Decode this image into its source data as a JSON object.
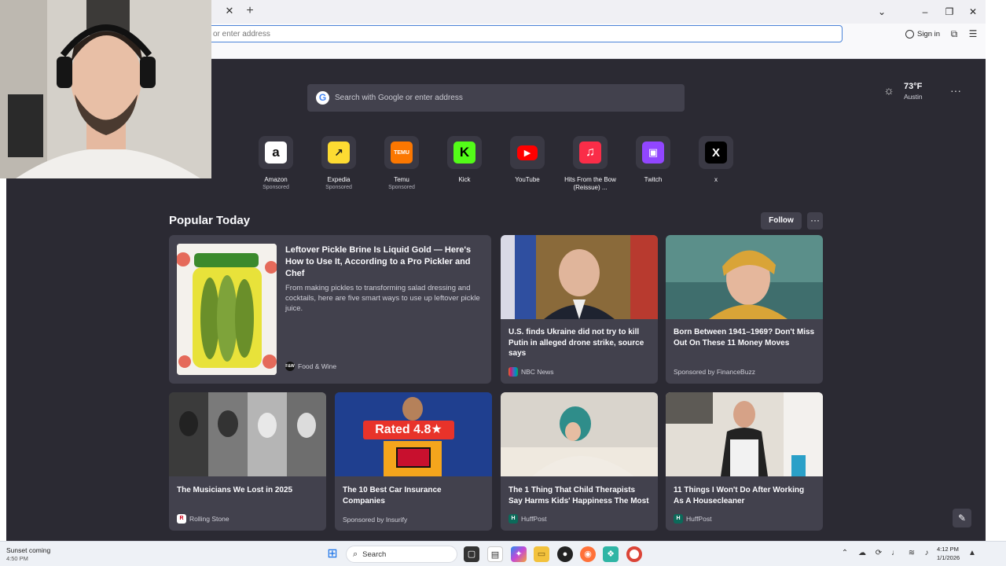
{
  "browser": {
    "address_placeholder": "or enter address",
    "sign_in": "Sign in"
  },
  "newtab": {
    "search_placeholder": "Search with Google or enter address",
    "weather": {
      "temp": "73°F",
      "location": "Austin"
    },
    "shortcuts": [
      {
        "label": "Amazon",
        "sponsor": "Sponsored",
        "icon": "amazon-icon",
        "color": "#ffffff",
        "glyph": "a"
      },
      {
        "label": "Expedia",
        "sponsor": "Sponsored",
        "icon": "expedia-icon",
        "color": "#fddb32",
        "glyph": "↗"
      },
      {
        "label": "Temu",
        "sponsor": "Sponsored",
        "icon": "temu-icon",
        "color": "#fb7701",
        "glyph": "TEMU"
      },
      {
        "label": "Kick",
        "sponsor": "",
        "icon": "kick-icon",
        "color": "#53fc18",
        "glyph": "K"
      },
      {
        "label": "YouTube",
        "sponsor": "",
        "icon": "youtube-icon",
        "color": "#ff0000",
        "glyph": "▶"
      },
      {
        "label": "Hits From the Bow (Reissue) ...",
        "sponsor": "",
        "icon": "apple-music-icon",
        "color": "#fa2d48",
        "glyph": "♫"
      },
      {
        "label": "Twitch",
        "sponsor": "",
        "icon": "twitch-icon",
        "color": "#9146ff",
        "glyph": "▣"
      },
      {
        "label": "x",
        "sponsor": "",
        "icon": "x-icon",
        "color": "#000000",
        "glyph": "X"
      }
    ],
    "section": {
      "title": "Popular Today",
      "follow": "Follow",
      "more": "···"
    },
    "featured": {
      "title": "Leftover Pickle Brine Is Liquid Gold — Here's How to Use It, According to a Pro Pickler and Chef",
      "excerpt": "From making pickles to transforming salad dressing and cocktails, here are five smart ways to use up leftover pickle juice.",
      "source": "Food & Wine",
      "badge": "F&W"
    },
    "cards_top": [
      {
        "title": "U.S. finds Ukraine did not try to kill Putin in alleged drone strike, source says",
        "source": "NBC News",
        "badge": "N"
      },
      {
        "title": "Born Between 1941–1969? Don't Miss Out On These 11 Money Moves",
        "source": "Sponsored by FinanceBuzz",
        "badge": ""
      }
    ],
    "cards_bottom": [
      {
        "title": "The Musicians We Lost in 2025",
        "source": "Rolling Stone",
        "badge": "R"
      },
      {
        "title": "The 10 Best Car Insurance Companies",
        "source": "Sponsored by Insurify",
        "badge": "",
        "img_text": "Rated 4.8★"
      },
      {
        "title": "The 1 Thing That Child Therapists Say Harms Kids' Happiness The Most",
        "source": "HuffPost",
        "badge": "H"
      },
      {
        "title": "11 Things I Won't Do After Working As A Housecleaner",
        "source": "HuffPost",
        "badge": "H"
      }
    ]
  },
  "taskbar": {
    "weather_title": "Sunset coming",
    "weather_time": "4:50 PM",
    "search_label": "Search",
    "clock_time": "4:12 PM",
    "clock_date": "1/1/2026"
  }
}
